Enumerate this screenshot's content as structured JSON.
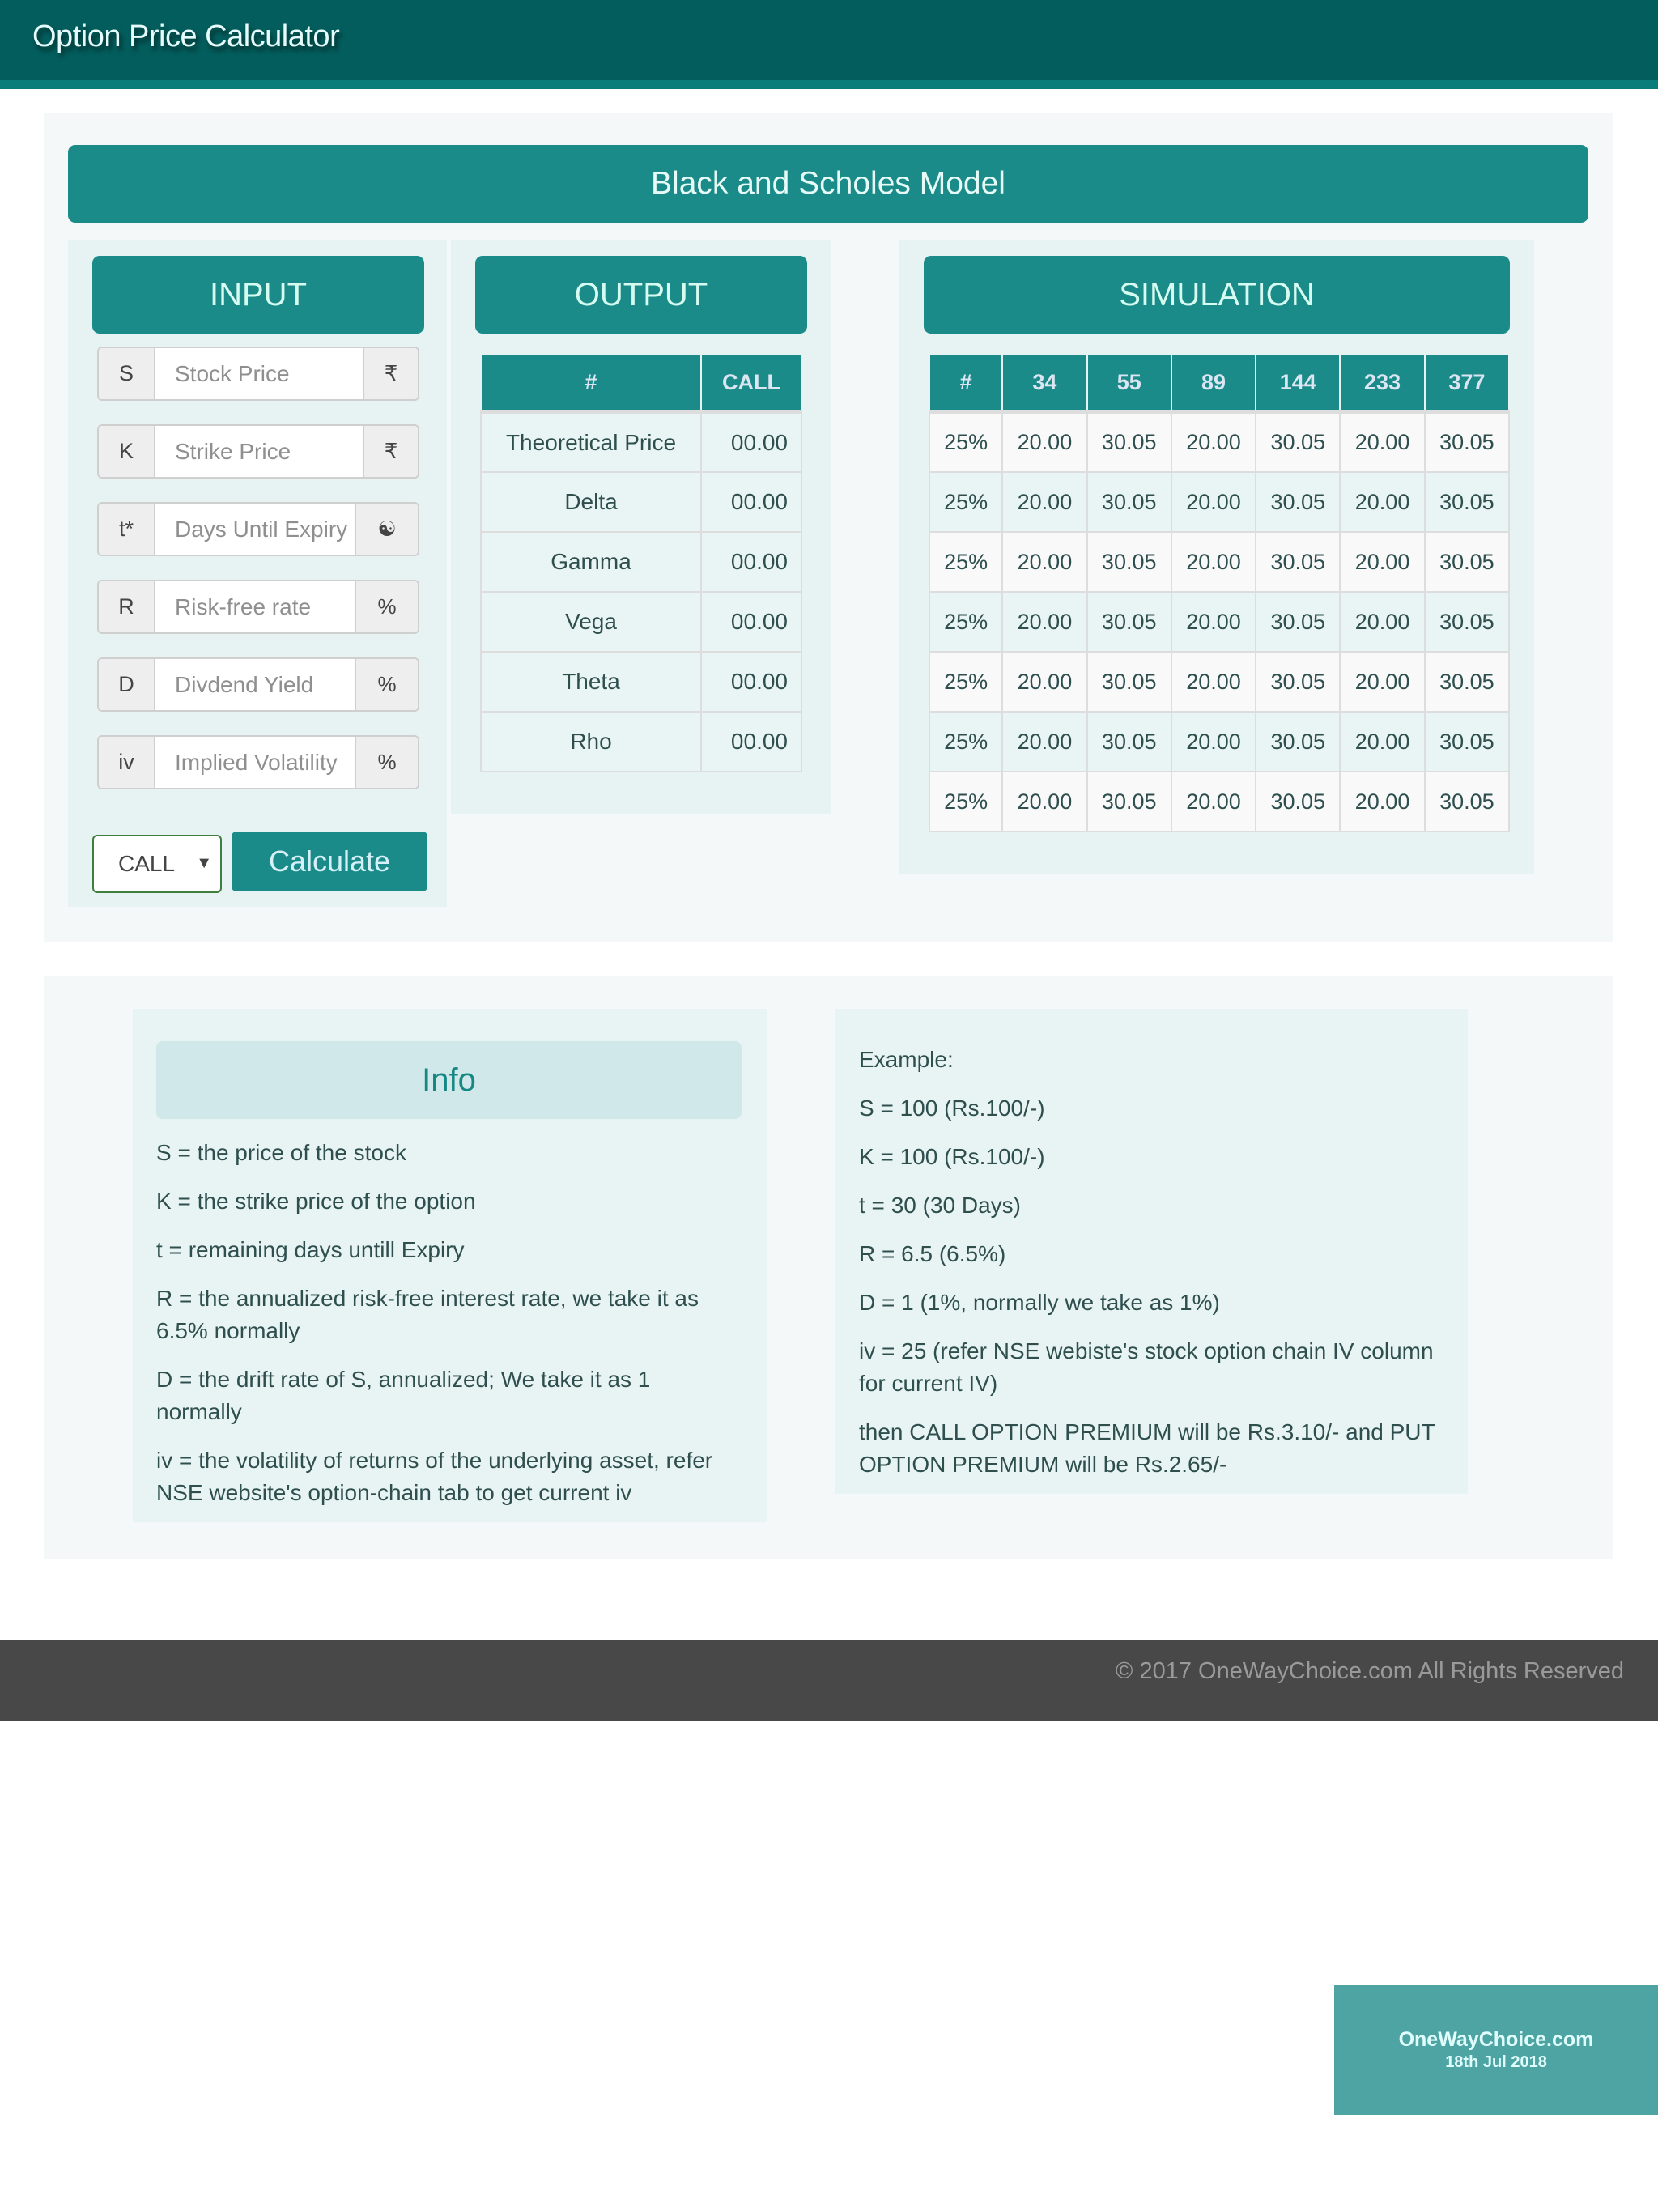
{
  "header": {
    "title": "Option Price Calculator"
  },
  "banner": {
    "title": "Black and Scholes Model"
  },
  "input": {
    "heading": "INPUT",
    "fields": [
      {
        "label": "S",
        "placeholder": "Stock Price",
        "value": "",
        "suffix": "₹",
        "suffix_icon": "rupee-icon"
      },
      {
        "label": "K",
        "placeholder": "Strike Price",
        "value": "",
        "suffix": "₹",
        "suffix_icon": "rupee-icon"
      },
      {
        "label": "t*",
        "placeholder": "Days Until Expiry",
        "value": "",
        "suffix": "☯",
        "suffix_icon": "yin-yang-icon"
      },
      {
        "label": "R",
        "placeholder": "Risk-free rate",
        "value": "",
        "suffix": "%",
        "suffix_icon": "percent-icon"
      },
      {
        "label": "D",
        "placeholder": "Divdend Yield",
        "value": "",
        "suffix": "%",
        "suffix_icon": "percent-icon"
      },
      {
        "label": "iv",
        "placeholder": "Implied Volatility",
        "value": "",
        "suffix": "%",
        "suffix_icon": "percent-icon"
      }
    ],
    "option_type": {
      "selected": "CALL",
      "arrow": "▼"
    },
    "calculate_label": "Calculate"
  },
  "output": {
    "heading": "OUTPUT",
    "columns": [
      "#",
      "CALL"
    ],
    "rows": [
      {
        "name": "Theoretical Price",
        "value": "00.00"
      },
      {
        "name": "Delta",
        "value": "00.00"
      },
      {
        "name": "Gamma",
        "value": "00.00"
      },
      {
        "name": "Vega",
        "value": "00.00"
      },
      {
        "name": "Theta",
        "value": "00.00"
      },
      {
        "name": "Rho",
        "value": "00.00"
      }
    ]
  },
  "simulation": {
    "heading": "SIMULATION",
    "columns": [
      "#",
      "34",
      "55",
      "89",
      "144",
      "233",
      "377"
    ],
    "rows": [
      [
        "25%",
        "20.00",
        "30.05",
        "20.00",
        "30.05",
        "20.00",
        "30.05"
      ],
      [
        "25%",
        "20.00",
        "30.05",
        "20.00",
        "30.05",
        "20.00",
        "30.05"
      ],
      [
        "25%",
        "20.00",
        "30.05",
        "20.00",
        "30.05",
        "20.00",
        "30.05"
      ],
      [
        "25%",
        "20.00",
        "30.05",
        "20.00",
        "30.05",
        "20.00",
        "30.05"
      ],
      [
        "25%",
        "20.00",
        "30.05",
        "20.00",
        "30.05",
        "20.00",
        "30.05"
      ],
      [
        "25%",
        "20.00",
        "30.05",
        "20.00",
        "30.05",
        "20.00",
        "30.05"
      ],
      [
        "25%",
        "20.00",
        "30.05",
        "20.00",
        "30.05",
        "20.00",
        "30.05"
      ]
    ]
  },
  "info": {
    "heading": "Info",
    "items": [
      "S = the price of the stock",
      "K = the strike price of the option",
      "t = remaining days untill Expiry",
      "R = the annualized risk-free interest rate, we take it as 6.5% normally",
      "D = the drift rate of S, annualized; We take it as 1 normally",
      "iv = the volatility of returns of the underlying asset, refer NSE website's option-chain tab to get current iv"
    ]
  },
  "example": {
    "items": [
      "Example:",
      "S = 100 (Rs.100/-)",
      "K = 100 (Rs.100/-)",
      "t = 30 (30 Days)",
      "R = 6.5 (6.5%)",
      "D = 1 (1%, normally we take as 1%)",
      "iv = 25 (refer NSE webiste's stock option chain IV column for current IV)",
      "then CALL OPTION PREMIUM will be Rs.3.10/- and PUT OPTION PREMIUM will be Rs.2.65/-"
    ]
  },
  "footer": {
    "text": "© 2017 OneWayChoice.com All Rights Reserved"
  },
  "badge": {
    "site": "OneWayChoice.com",
    "date": "18th Jul 2018"
  },
  "colors": {
    "header": "#035d5c",
    "accent": "#1a8b89",
    "footer": "#484848",
    "badge": "#4da4a3"
  }
}
